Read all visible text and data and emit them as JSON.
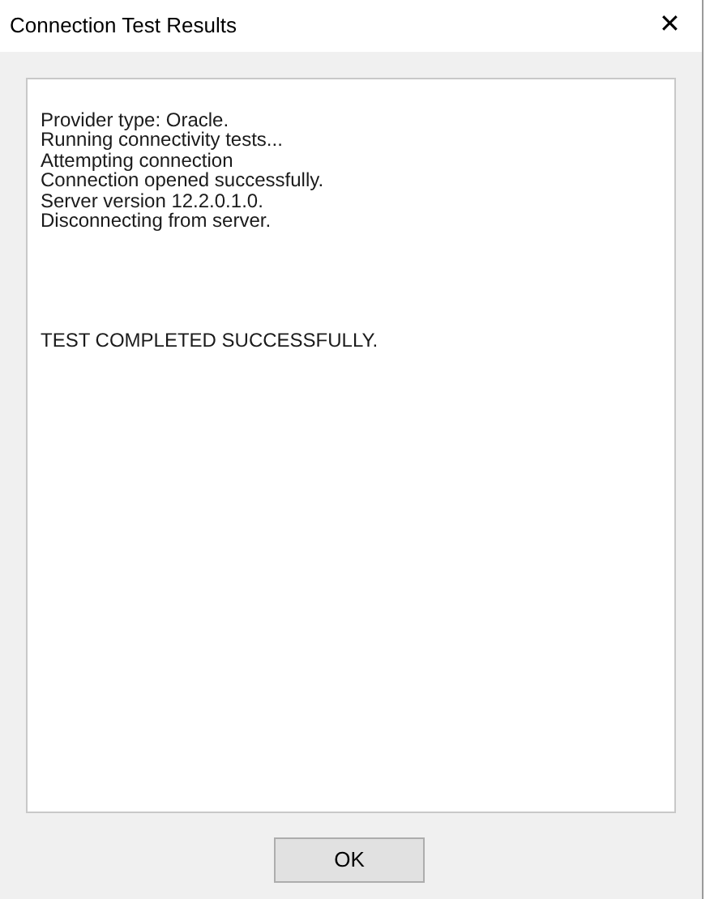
{
  "window": {
    "title": "Connection Test Results",
    "close": "✕"
  },
  "output": {
    "lines": [
      "Provider type: Oracle.",
      "Running connectivity tests...",
      "Attempting connection",
      "Connection opened successfully.",
      "Server version 12.2.0.1.0.",
      "Disconnecting from server."
    ],
    "result": "TEST COMPLETED SUCCESSFULLY."
  },
  "buttons": [
    "OK"
  ]
}
